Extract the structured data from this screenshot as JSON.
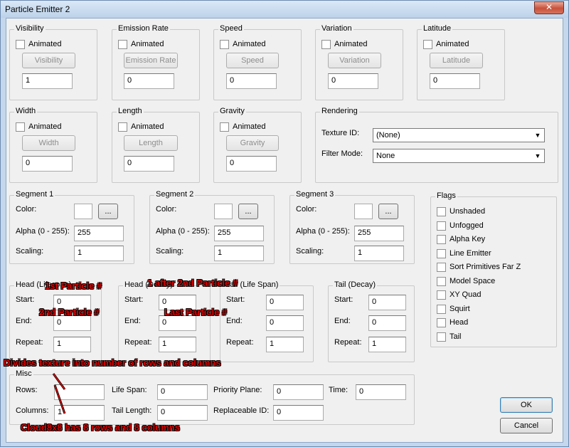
{
  "window": {
    "title": "Particle Emitter 2",
    "close_glyph": "✕"
  },
  "common": {
    "animated_label": "Animated",
    "color_label": "Color:",
    "alpha_label": "Alpha (0 - 255):",
    "scaling_label": "Scaling:",
    "browse_glyph": "...",
    "start_label": "Start:",
    "end_label": "End:",
    "repeat_label": "Repeat:",
    "dropdown_arrow": "▼"
  },
  "top_groups": [
    {
      "title": "Visibility",
      "button": "Visibility",
      "value": "1"
    },
    {
      "title": "Emission Rate",
      "button": "Emission Rate",
      "value": "0"
    },
    {
      "title": "Speed",
      "button": "Speed",
      "value": "0"
    },
    {
      "title": "Variation",
      "button": "Variation",
      "value": "0"
    },
    {
      "title": "Latitude",
      "button": "Latitude",
      "value": "0"
    }
  ],
  "mid_groups": [
    {
      "title": "Width",
      "button": "Width",
      "value": "0"
    },
    {
      "title": "Length",
      "button": "Length",
      "value": "0"
    },
    {
      "title": "Gravity",
      "button": "Gravity",
      "value": "0"
    }
  ],
  "rendering": {
    "title": "Rendering",
    "texture_label": "Texture ID:",
    "texture_value": "(None)",
    "filter_label": "Filter Mode:",
    "filter_value": "None"
  },
  "segments": [
    {
      "title": "Segment 1",
      "alpha": "255",
      "scaling": "1"
    },
    {
      "title": "Segment 2",
      "alpha": "255",
      "scaling": "1"
    },
    {
      "title": "Segment 3",
      "alpha": "255",
      "scaling": "1"
    }
  ],
  "flags": {
    "title": "Flags",
    "items": [
      "Unshaded",
      "Unfogged",
      "Alpha Key",
      "Line Emitter",
      "Sort Primitives Far Z",
      "Model Space",
      "XY Quad",
      "Squirt",
      "Head",
      "Tail"
    ]
  },
  "lifespan_groups": [
    {
      "title": "Head (Lifespan)",
      "start": "0",
      "end": "0",
      "repeat": "1"
    },
    {
      "title": "Head (Decay)",
      "start": "0",
      "end": "0",
      "repeat": "1"
    },
    {
      "title": "Tail (Life Span)",
      "start": "0",
      "end": "0",
      "repeat": "1"
    },
    {
      "title": "Tail (Decay)",
      "start": "0",
      "end": "0",
      "repeat": "1"
    }
  ],
  "misc": {
    "title": "Misc",
    "rows_label": "Rows:",
    "rows_value": "",
    "columns_label": "Columns:",
    "columns_value": "1",
    "lifespan_label": "Life Span:",
    "lifespan_value": "0",
    "tail_length_label": "Tail Length:",
    "tail_length_value": "0",
    "priority_label": "Priority Plane:",
    "priority_value": "0",
    "replaceable_label": "Replaceable ID:",
    "replaceable_value": "0",
    "time_label": "Time:",
    "time_value": "0"
  },
  "buttons": {
    "ok": "OK",
    "cancel": "Cancel"
  },
  "annotations": {
    "first_particle": "1st Particle #",
    "second_particle": "2nd Particle #",
    "one_after_second": "1 after 2nd Particle #",
    "last_particle": "Last Particle #",
    "divides_texture": "Divides texture into number of rows and columns",
    "cloud_note": "Cloud8x8 has 8 rows and 8 columns"
  }
}
